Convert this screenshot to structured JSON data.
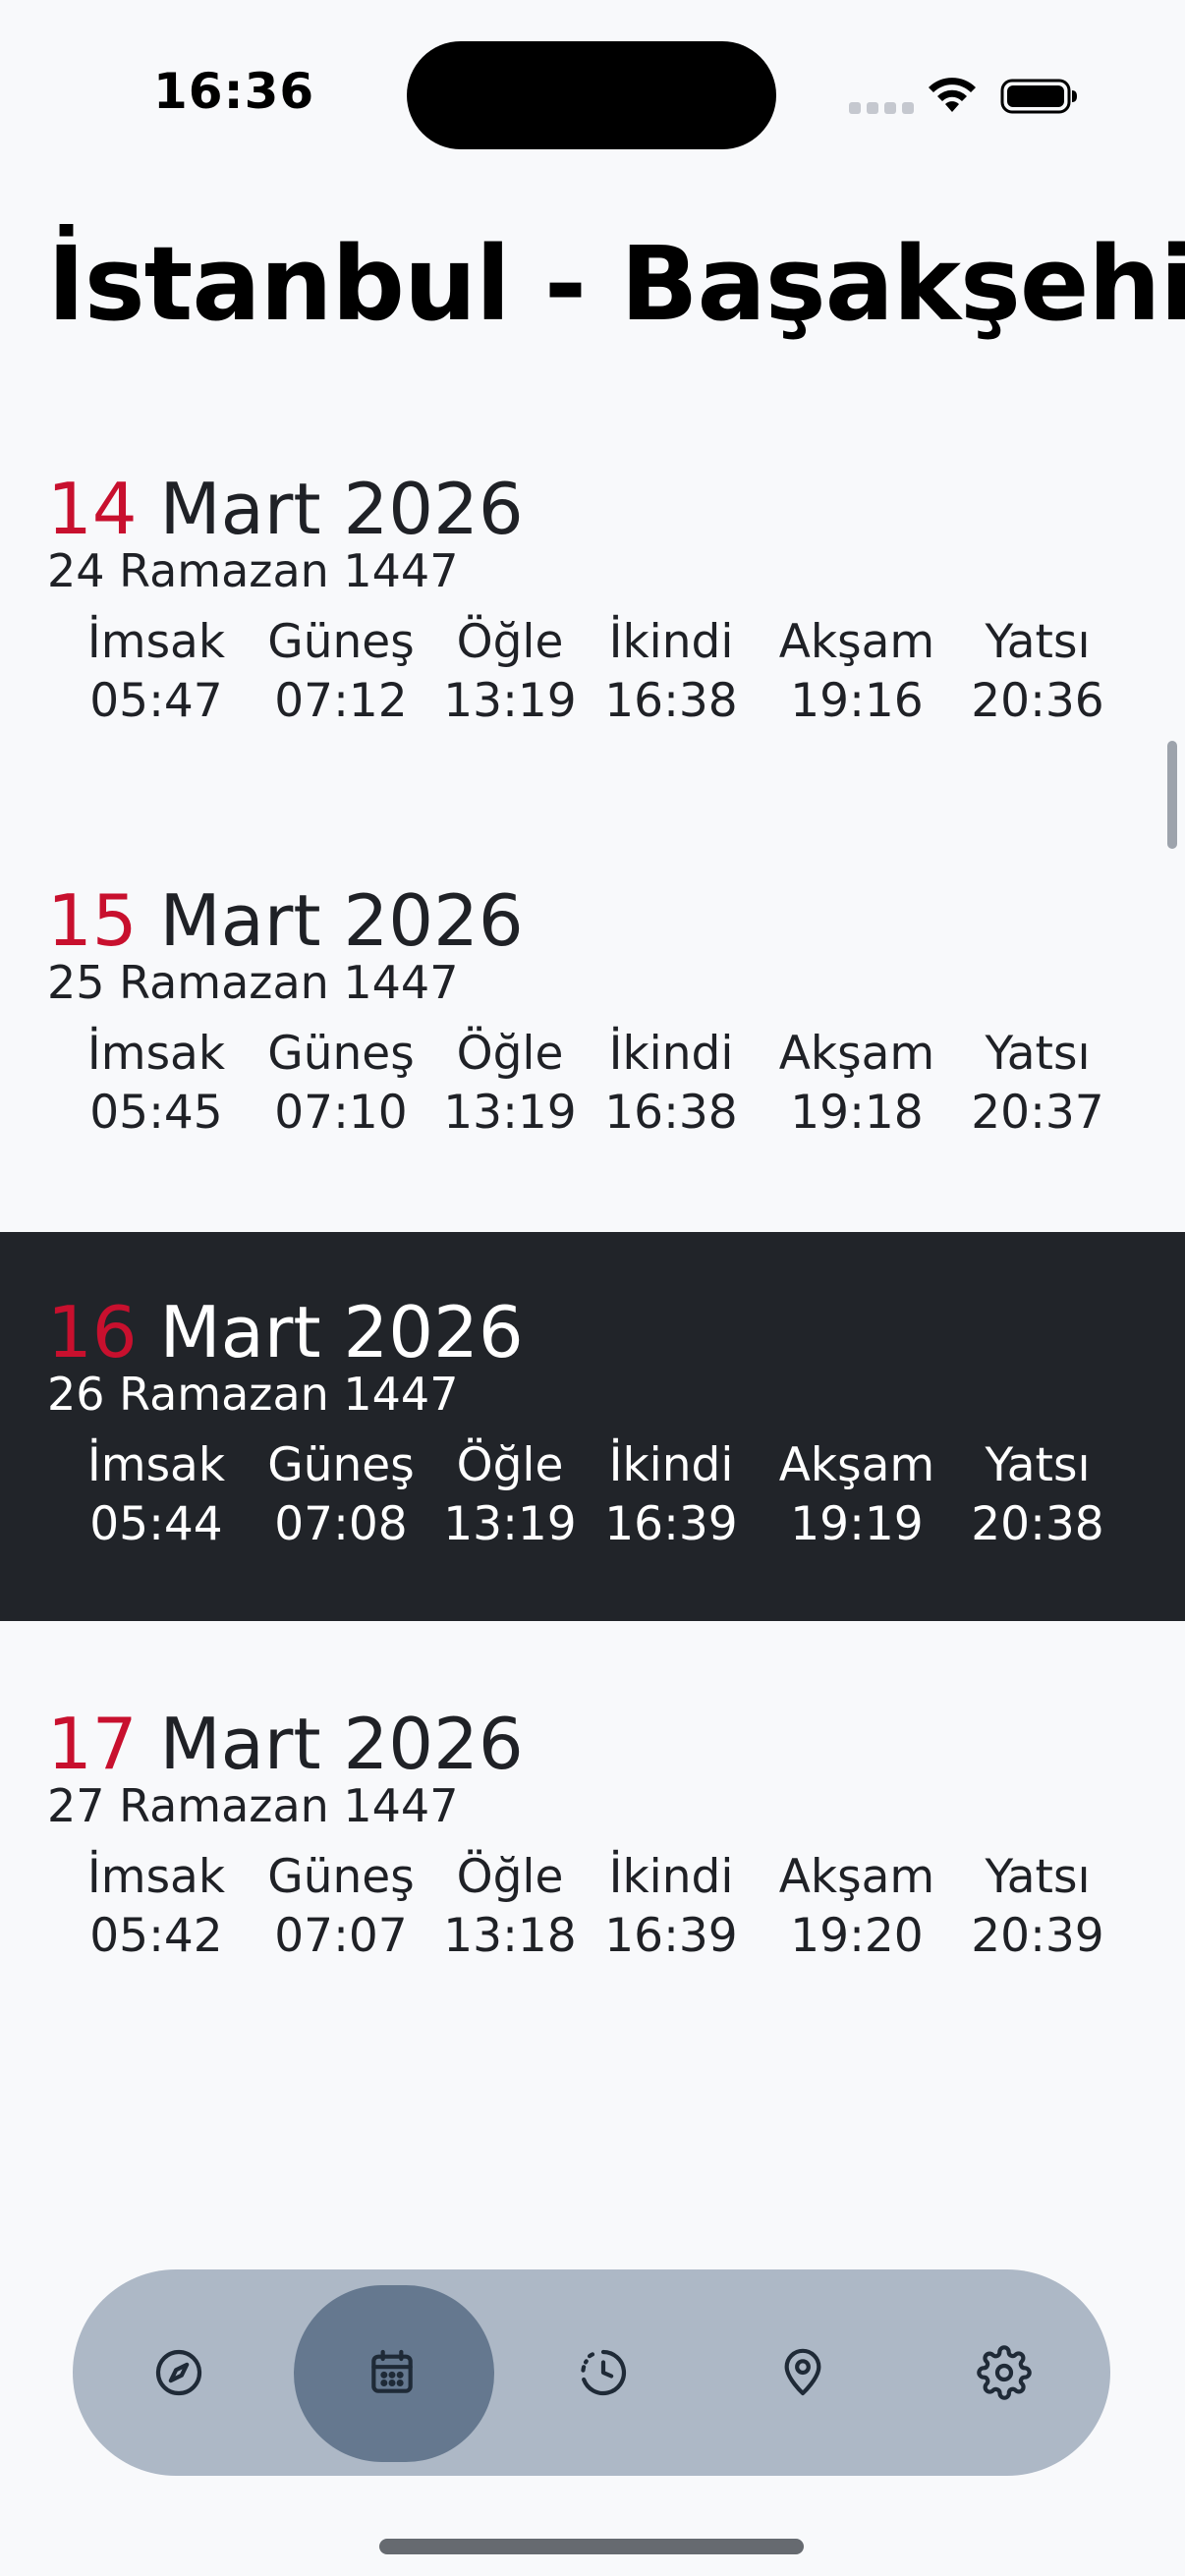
{
  "status_bar": {
    "time": "16:36"
  },
  "header": {
    "title": "İstanbul - Başakşehir"
  },
  "prayer_labels": [
    "İmsak",
    "Güneş",
    "Öğle",
    "İkindi",
    "Akşam",
    "Yatsı"
  ],
  "days": [
    {
      "day": "14",
      "month_year": "Mart 2026",
      "hijri": "24 Ramazan 1447",
      "times": [
        "05:47",
        "07:12",
        "13:19",
        "16:38",
        "19:16",
        "20:36"
      ],
      "selected": false
    },
    {
      "day": "15",
      "month_year": "Mart 2026",
      "hijri": "25 Ramazan 1447",
      "times": [
        "05:45",
        "07:10",
        "13:19",
        "16:38",
        "19:18",
        "20:37"
      ],
      "selected": false
    },
    {
      "day": "16",
      "month_year": "Mart 2026",
      "hijri": "26 Ramazan 1447",
      "times": [
        "05:44",
        "07:08",
        "13:19",
        "16:39",
        "19:19",
        "20:38"
      ],
      "selected": true
    },
    {
      "day": "17",
      "month_year": "Mart 2026",
      "hijri": "27 Ramazan 1447",
      "times": [
        "05:42",
        "07:07",
        "13:18",
        "16:39",
        "19:20",
        "20:39"
      ],
      "selected": false
    }
  ],
  "tab_bar": {
    "tabs": [
      {
        "icon": "compass-icon",
        "active": false
      },
      {
        "icon": "calendar-icon",
        "active": true
      },
      {
        "icon": "clock-history-icon",
        "active": false
      },
      {
        "icon": "location-pin-icon",
        "active": false
      },
      {
        "icon": "gear-icon",
        "active": false
      }
    ]
  },
  "colors": {
    "accent_red": "#c8102e",
    "selected_row_bg": "#212429",
    "tab_bar_bg": "#adb8c6",
    "tab_active_bg": "#65788f"
  }
}
